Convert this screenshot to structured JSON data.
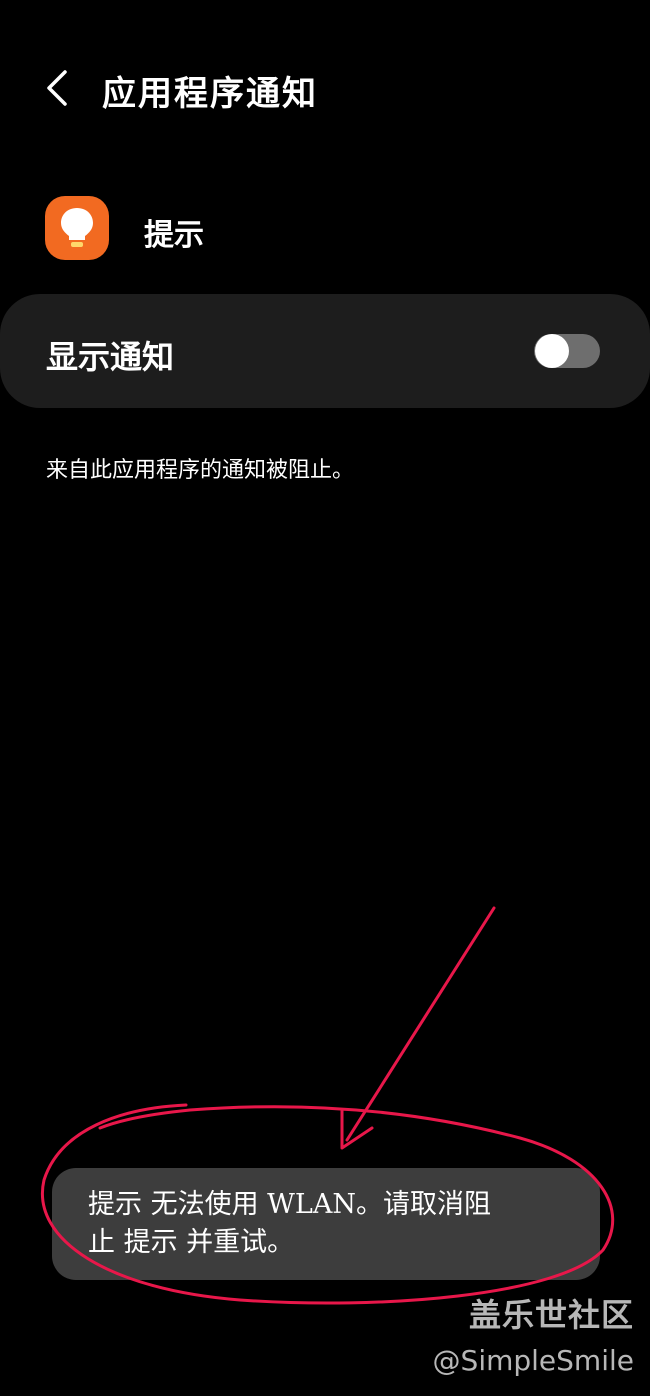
{
  "header": {
    "title": "应用程序通知"
  },
  "app": {
    "name": "提示",
    "icon": "lightbulb-icon",
    "icon_color": "#f26a21"
  },
  "notification_toggle": {
    "label": "显示通知",
    "enabled": false
  },
  "blocked_message": "来自此应用程序的通知被阻止。",
  "toast": {
    "line1": "提示 无法使用 WLAN。请取消阻",
    "line2": "止 提示 并重试。"
  },
  "annotation": {
    "color": "#e8174a"
  },
  "watermark": {
    "site": "盖乐世社区",
    "user": "@SimpleSmile"
  }
}
